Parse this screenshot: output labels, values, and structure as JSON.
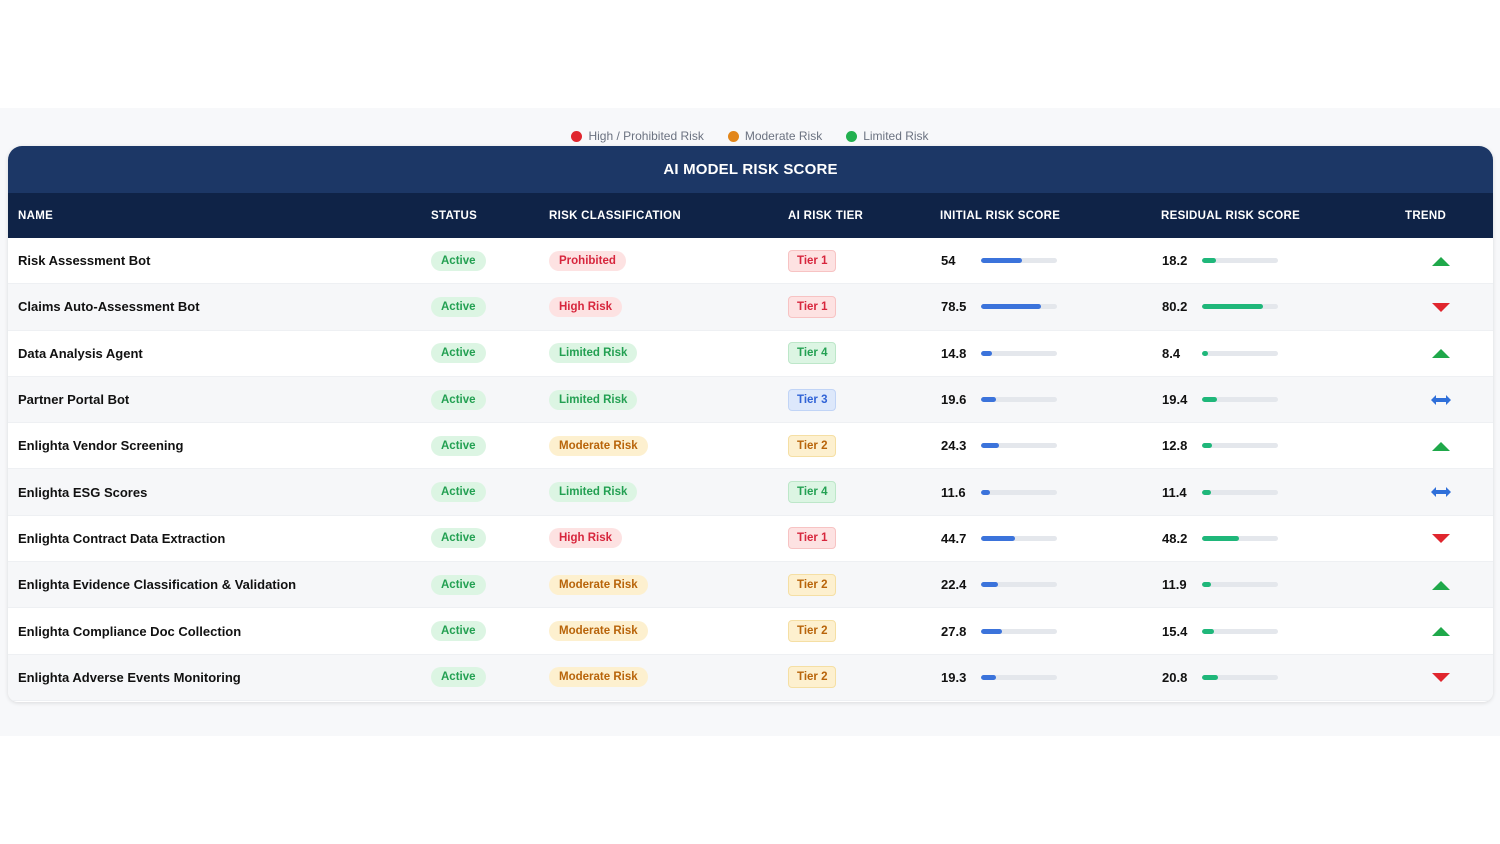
{
  "legend": [
    {
      "label": "High / Prohibited Risk",
      "color": "#e0262e"
    },
    {
      "label": "Moderate Risk",
      "color": "#e2861a"
    },
    {
      "label": "Limited Risk",
      "color": "#22b04f"
    }
  ],
  "table": {
    "title": "AI MODEL RISK SCORE",
    "headers": {
      "name": "NAME",
      "status": "STATUS",
      "classification": "RISK CLASSIFICATION",
      "tier": "AI RISK TIER",
      "initial": "INITIAL RISK SCORE",
      "residual": "RESIDUAL RISK SCORE",
      "trend": "TREND"
    },
    "rows": [
      {
        "name": "Risk Assessment Bot",
        "status": "Active",
        "classification": "Prohibited",
        "class_key": "prohibited",
        "tier": "Tier 1",
        "tier_key": "t1",
        "initial": "54",
        "initial_pct": 54,
        "residual": "18.2",
        "residual_pct": 18.2,
        "trend": "up"
      },
      {
        "name": "Claims Auto-Assessment Bot",
        "status": "Active",
        "classification": "High Risk",
        "class_key": "high",
        "tier": "Tier 1",
        "tier_key": "t1",
        "initial": "78.5",
        "initial_pct": 78.5,
        "residual": "80.2",
        "residual_pct": 80.2,
        "trend": "down"
      },
      {
        "name": "Data Analysis Agent",
        "status": "Active",
        "classification": "Limited Risk",
        "class_key": "limited",
        "tier": "Tier 4",
        "tier_key": "t4",
        "initial": "14.8",
        "initial_pct": 14.8,
        "residual": "8.4",
        "residual_pct": 8.4,
        "trend": "up"
      },
      {
        "name": "Partner Portal Bot",
        "status": "Active",
        "classification": "Limited Risk",
        "class_key": "limited",
        "tier": "Tier 3",
        "tier_key": "t3",
        "initial": "19.6",
        "initial_pct": 19.6,
        "residual": "19.4",
        "residual_pct": 19.4,
        "trend": "flat"
      },
      {
        "name": "Enlighta Vendor Screening",
        "status": "Active",
        "classification": "Moderate Risk",
        "class_key": "moderate",
        "tier": "Tier 2",
        "tier_key": "t2",
        "initial": "24.3",
        "initial_pct": 24.3,
        "residual": "12.8",
        "residual_pct": 12.8,
        "trend": "up"
      },
      {
        "name": "Enlighta ESG Scores",
        "status": "Active",
        "classification": "Limited Risk",
        "class_key": "limited",
        "tier": "Tier 4",
        "tier_key": "t4",
        "initial": "11.6",
        "initial_pct": 11.6,
        "residual": "11.4",
        "residual_pct": 11.4,
        "trend": "flat"
      },
      {
        "name": "Enlighta Contract Data Extraction",
        "status": "Active",
        "classification": "High Risk",
        "class_key": "high",
        "tier": "Tier 1",
        "tier_key": "t1",
        "initial": "44.7",
        "initial_pct": 44.7,
        "residual": "48.2",
        "residual_pct": 48.2,
        "trend": "down"
      },
      {
        "name": "Enlighta Evidence Classification & Validation",
        "status": "Active",
        "classification": "Moderate Risk",
        "class_key": "moderate",
        "tier": "Tier 2",
        "tier_key": "t2",
        "initial": "22.4",
        "initial_pct": 22.4,
        "residual": "11.9",
        "residual_pct": 11.9,
        "trend": "up"
      },
      {
        "name": "Enlighta Compliance Doc Collection",
        "status": "Active",
        "classification": "Moderate Risk",
        "class_key": "moderate",
        "tier": "Tier 2",
        "tier_key": "t2",
        "initial": "27.8",
        "initial_pct": 27.8,
        "residual": "15.4",
        "residual_pct": 15.4,
        "trend": "up"
      },
      {
        "name": "Enlighta Adverse Events Monitoring",
        "status": "Active",
        "classification": "Moderate Risk",
        "class_key": "moderate",
        "tier": "Tier 2",
        "tier_key": "t2",
        "initial": "19.3",
        "initial_pct": 19.3,
        "residual": "20.8",
        "residual_pct": 20.8,
        "trend": "down"
      }
    ]
  },
  "trend_icons": {
    "up": "arrow-up-icon",
    "down": "arrow-down-icon",
    "flat": "arrow-left-right-icon"
  },
  "colors": {
    "up": "#1fa84a",
    "down": "#e0262e",
    "flat": "#2f6fd9",
    "header_bg": "#0f2347",
    "title_bg": "#1c3766"
  }
}
